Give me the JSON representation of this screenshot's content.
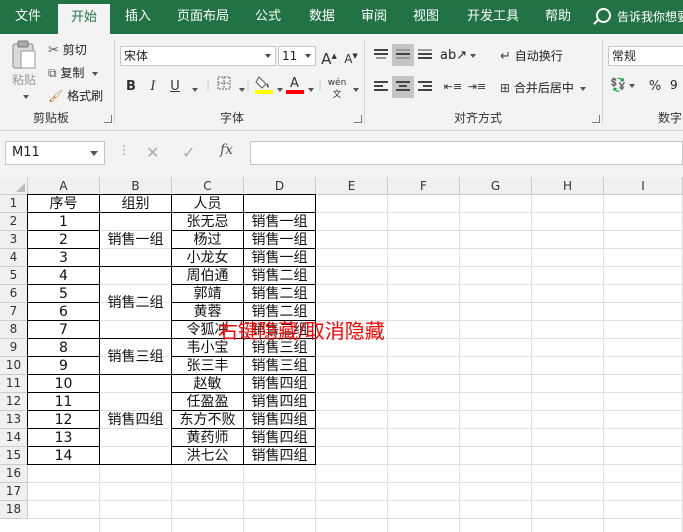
{
  "ribbon_tabs": [
    "文件",
    "开始",
    "插入",
    "页面布局",
    "公式",
    "数据",
    "审阅",
    "视图",
    "开发工具",
    "帮助"
  ],
  "tell_me": "告诉我你想要",
  "clipboard": {
    "paste": "粘贴",
    "cut": "剪切",
    "copy": "复制",
    "format_painter": "格式刷",
    "label": "剪贴板"
  },
  "font": {
    "name": "宋体",
    "size": "11",
    "grow": "A",
    "shrink": "A",
    "bold": "B",
    "italic": "I",
    "underline": "U",
    "label": "字体"
  },
  "alignment": {
    "wrap_text": "自动换行",
    "merge_center": "合并后居中",
    "label": "对齐方式"
  },
  "number": {
    "format": "常规",
    "percent": "%",
    "label": "数字"
  },
  "colors": {
    "ribbon_green": "#217346",
    "fill_yellow": "#ffff00",
    "font_red": "#ff0000"
  },
  "formula_bar": {
    "name_box": "M11",
    "fx": "fx",
    "value": ""
  },
  "columns": [
    "A",
    "B",
    "C",
    "D",
    "E",
    "F",
    "G",
    "H",
    "I"
  ],
  "rows": [
    "1",
    "2",
    "3",
    "4",
    "5",
    "6",
    "7",
    "8",
    "9",
    "10",
    "11",
    "12",
    "13",
    "14",
    "15",
    "16",
    "17",
    "18"
  ],
  "table": {
    "headers": [
      "序号",
      "组别",
      "人员",
      ""
    ],
    "seq": [
      "1",
      "2",
      "3",
      "4",
      "5",
      "6",
      "7",
      "8",
      "9",
      "10",
      "11",
      "12",
      "13",
      "14"
    ],
    "groups": [
      "销售一组",
      "销售二组",
      "销售三组",
      "销售四组"
    ],
    "people": [
      "张无忌",
      "杨过",
      "小龙女",
      "周伯通",
      "郭靖",
      "黄蓉",
      "令狐冲",
      "韦小宝",
      "张三丰",
      "赵敏",
      "任盈盈",
      "东方不败",
      "黄药师",
      "洪七公"
    ],
    "team": [
      "销售一组",
      "销售一组",
      "销售一组",
      "销售二组",
      "销售二组",
      "销售二组",
      "销售二组",
      "销售三组",
      "销售三组",
      "销售四组",
      "销售四组",
      "销售四组",
      "销售四组",
      "销售四组"
    ]
  },
  "caption": "右键隐藏/取消隐藏"
}
